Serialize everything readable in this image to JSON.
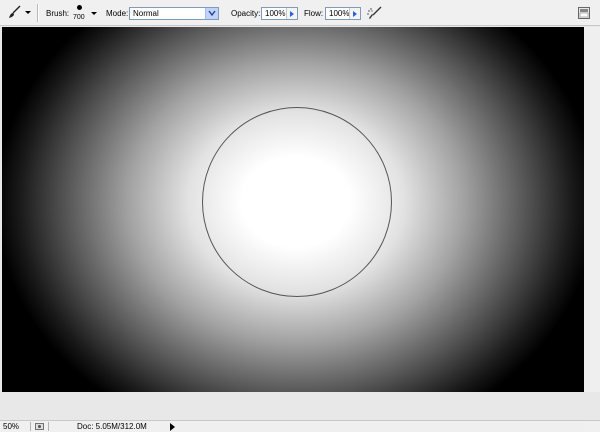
{
  "options_bar": {
    "tool_preset_icon": "brush-icon",
    "brush_label": "Brush:",
    "brush_size": "700",
    "mode_label": "Mode:",
    "mode_value": "Normal",
    "opacity_label": "Opacity:",
    "opacity_value": "100%",
    "flow_label": "Flow:",
    "flow_value": "100%",
    "airbrush_icon": "airbrush-icon",
    "palette_icon": "palette-well-icon"
  },
  "canvas": {
    "background": "#000000",
    "glow_center_color": "#ffffff"
  },
  "status_bar": {
    "zoom": "50%",
    "doc_info": "Doc: 5.05M/312.0M"
  }
}
